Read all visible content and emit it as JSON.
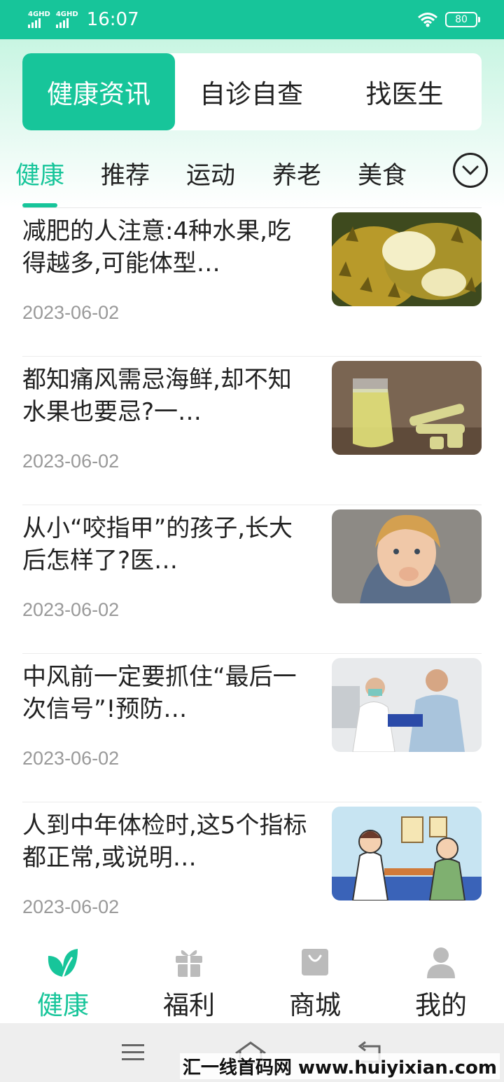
{
  "status_bar": {
    "signal1_label": "4GHD",
    "signal2_label": "4GHD",
    "time": "16:07",
    "battery": "80"
  },
  "segment_tabs": [
    {
      "label": "健康资讯",
      "active": true
    },
    {
      "label": "自诊自查",
      "active": false
    },
    {
      "label": "找医生",
      "active": false
    }
  ],
  "categories": [
    {
      "label": "健康",
      "active": true
    },
    {
      "label": "推荐",
      "active": false
    },
    {
      "label": "运动",
      "active": false
    },
    {
      "label": "养老",
      "active": false
    },
    {
      "label": "美食",
      "active": false
    }
  ],
  "news": [
    {
      "title": "减肥的人注意:4种水果,吃得越多,可能体型…",
      "date": "2023-06-02",
      "thumb_icon": "durian-photo"
    },
    {
      "title": "都知痛风需忌海鲜,却不知水果也要忌?一…",
      "date": "2023-06-02",
      "thumb_icon": "sugarcane-juice-photo"
    },
    {
      "title": "从小“咬指甲”的孩子,长大后怎样了?医…",
      "date": "2023-06-02",
      "thumb_icon": "child-biting-nails-photo"
    },
    {
      "title": "中风前一定要抓住“最后一次信号”!预防…",
      "date": "2023-06-02",
      "thumb_icon": "doctor-patient-photo"
    },
    {
      "title": "人到中年体检时,这5个指标都正常,或说明…",
      "date": "2023-06-02",
      "thumb_icon": "nurse-elderly-illustration"
    }
  ],
  "bottom_nav": [
    {
      "label": "健康",
      "icon": "leaf-icon",
      "active": true
    },
    {
      "label": "福利",
      "icon": "gift-icon",
      "active": false
    },
    {
      "label": "商城",
      "icon": "shopping-bag-icon",
      "active": false
    },
    {
      "label": "我的",
      "icon": "user-icon",
      "active": false
    }
  ],
  "watermark": "汇一线首码网 www.huiyixian.com",
  "colors": {
    "accent": "#17c59a",
    "text": "#222222",
    "muted": "#999999"
  }
}
